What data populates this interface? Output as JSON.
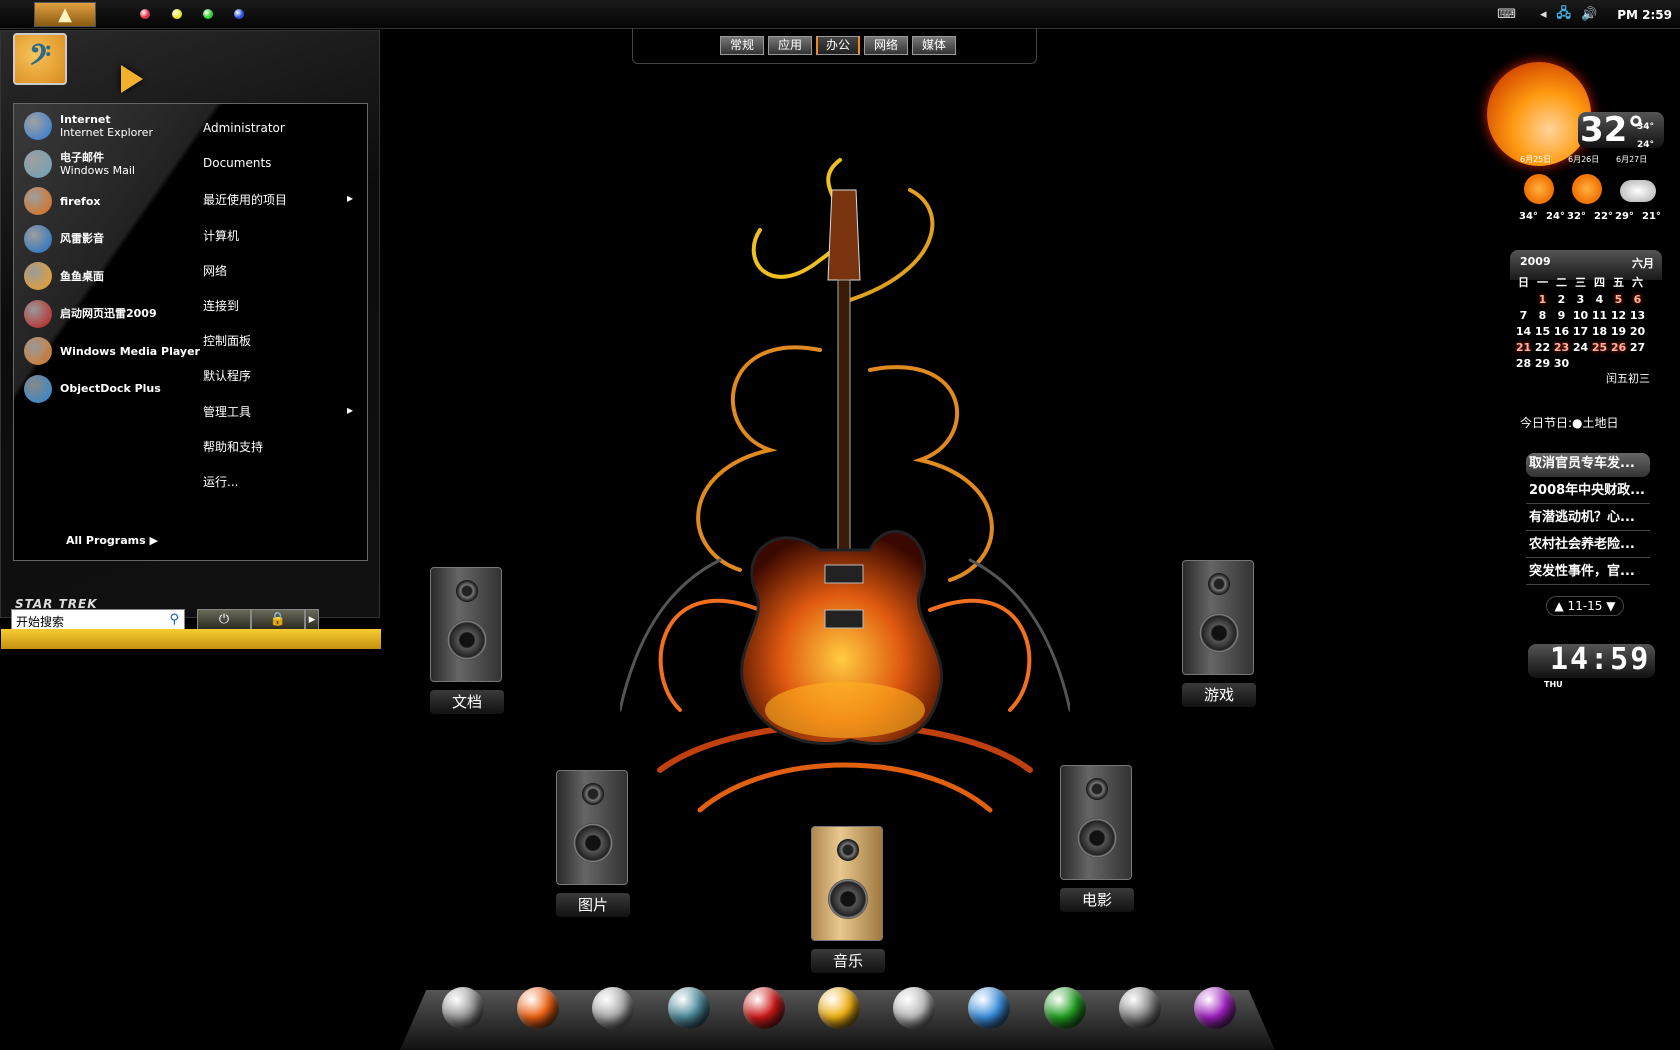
{
  "topbar": {
    "dot_colors": [
      "#e0304a",
      "#e8e830",
      "#30d030",
      "#3050e0"
    ],
    "tray": {
      "keyboard_icon": "keyboard-icon",
      "expand_icon": "chevron-left-icon",
      "network_icon": "network-icon",
      "volume_icon": "volume-icon",
      "time": "PM 2:59"
    }
  },
  "start_menu": {
    "pinned": [
      {
        "title": "Internet",
        "subtitle": "Internet Explorer",
        "icon": "ie-icon",
        "color": "#2a7ad8"
      },
      {
        "title": "电子邮件",
        "subtitle": "Windows Mail",
        "icon": "mail-icon",
        "color": "#6aa0b8"
      },
      {
        "title": "firefox",
        "icon": "firefox-icon",
        "color": "#e06a10"
      },
      {
        "title": "风雷影音",
        "icon": "player-icon",
        "color": "#1a70c8"
      },
      {
        "title": "鱼鱼桌面",
        "icon": "fish-desktop-icon",
        "color": "#f0a020"
      },
      {
        "title": "启动网页迅雷2009",
        "icon": "thunder-icon",
        "color": "#c01818"
      },
      {
        "title": "Windows Media Player",
        "icon": "media-player-icon",
        "color": "#e07a20"
      },
      {
        "title": "ObjectDock Plus",
        "icon": "objectdock-icon",
        "color": "#2a88d8"
      }
    ],
    "right": [
      {
        "label": "Administrator"
      },
      {
        "label": "Documents"
      },
      {
        "label": "最近使用的项目",
        "arrow": "▸"
      },
      {
        "label": "计算机"
      },
      {
        "label": "网络"
      },
      {
        "label": "连接到"
      },
      {
        "label": "控制面板"
      },
      {
        "label": "默认程序"
      },
      {
        "label": "管理工具",
        "arrow": "▸"
      },
      {
        "label": "帮助和支持"
      },
      {
        "label": "运行..."
      }
    ],
    "all_programs": "All Programs",
    "brand": "STAR TREK",
    "search_placeholder": "开始搜索",
    "power_icon": "⏻",
    "lock_icon": "🔒",
    "more_icon": "▸"
  },
  "tabs": [
    {
      "label": "常规"
    },
    {
      "label": "应用"
    },
    {
      "label": "办公",
      "active": true
    },
    {
      "label": "网络"
    },
    {
      "label": "媒体"
    }
  ],
  "desktop_folders": [
    {
      "label": "文档"
    },
    {
      "label": "图片"
    },
    {
      "label": "音乐"
    },
    {
      "label": "电影"
    },
    {
      "label": "游戏"
    }
  ],
  "dock": {
    "icons": [
      {
        "name": "skull-icon",
        "color": "#999"
      },
      {
        "name": "fire-icon",
        "color": "#f06010"
      },
      {
        "name": "swirl-icon",
        "color": "#aaa"
      },
      {
        "name": "lightning-icon",
        "color": "#4a8a9a"
      },
      {
        "name": "heart-icon",
        "color": "#d01818"
      },
      {
        "name": "sun-icon",
        "color": "#f0b010"
      },
      {
        "name": "moon-icon",
        "color": "#bbb"
      },
      {
        "name": "triangle-icon",
        "color": "#3a90e0"
      },
      {
        "name": "tree-icon",
        "color": "#20a020"
      },
      {
        "name": "gear-icon",
        "color": "#888"
      },
      {
        "name": "purple-orb-icon",
        "color": "#a020c0"
      }
    ]
  },
  "weather": {
    "current": "32°",
    "high": "34°",
    "low": "24°",
    "days": [
      {
        "date": "6月25日",
        "hi": "34°",
        "lo": "24°",
        "cond": "sunny"
      },
      {
        "date": "6月26日",
        "hi": "32°",
        "lo": "22°",
        "cond": "sunny"
      },
      {
        "date": "6月27日",
        "hi": "29°",
        "lo": "21°",
        "cond": "cloudy"
      }
    ]
  },
  "calendar": {
    "year": "2009",
    "month": "六月",
    "weekdays": [
      "日",
      "一",
      "二",
      "三",
      "四",
      "五",
      "六"
    ],
    "days": [
      "",
      "1",
      "2",
      "3",
      "4",
      "5",
      "6",
      "7",
      "8",
      "9",
      "10",
      "11",
      "12",
      "13",
      "14",
      "15",
      "16",
      "17",
      "18",
      "19",
      "20",
      "21",
      "22",
      "23",
      "24",
      "25",
      "26",
      "27",
      "28",
      "29",
      "30"
    ],
    "highlighted": [
      "1",
      "5",
      "6",
      "21",
      "23",
      "25",
      "26"
    ],
    "lunar": "闰五初三"
  },
  "holiday": "今日节日:●土地日",
  "news": {
    "items": [
      "取消官员专车发...",
      "2008年中央财政...",
      "有潜逃动机？心...",
      "农村社会养老险...",
      "突发性事件，官..."
    ],
    "pager": "▲ 11-15 ▼"
  },
  "clock": {
    "time": "14:59",
    "day": "THU"
  }
}
